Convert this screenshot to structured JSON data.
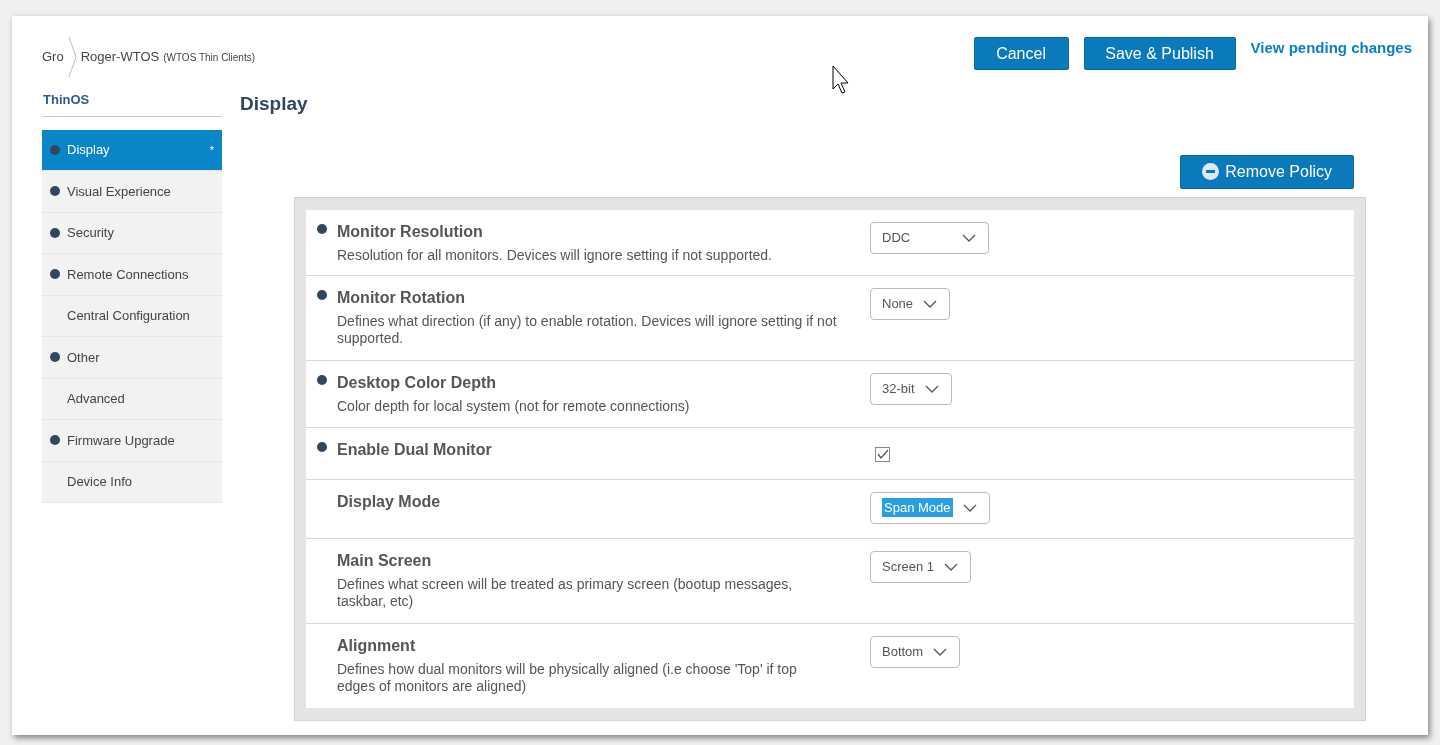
{
  "breadcrumb": {
    "parent": "Gro",
    "current": "Roger-WTOS",
    "context": "(WTOS Thin Clients)"
  },
  "header_buttons": [
    "Cancel",
    "Save & Publish"
  ],
  "pending_link": "View pending changes",
  "sidebar": {
    "title": "ThinOS",
    "items": [
      {
        "label": "Display",
        "configured": true,
        "selected": true,
        "modified_mark": "*"
      },
      {
        "label": "Visual Experience",
        "configured": true,
        "selected": false
      },
      {
        "label": "Security",
        "configured": true,
        "selected": false
      },
      {
        "label": "Remote Connections",
        "configured": true,
        "selected": false
      },
      {
        "label": "Central Configuration",
        "configured": false,
        "selected": false
      },
      {
        "label": "Other",
        "configured": true,
        "selected": false
      },
      {
        "label": "Advanced",
        "configured": false,
        "selected": false
      },
      {
        "label": "Firmware Upgrade",
        "configured": true,
        "selected": false
      },
      {
        "label": "Device Info",
        "configured": false,
        "selected": false
      }
    ]
  },
  "page_title": "Display",
  "remove_button": "Remove Policy",
  "settings": [
    {
      "kind": "select",
      "title": "Monitor Resolution",
      "description": "Resolution for all monitors. Devices will ignore setting if not supported.",
      "configured": true,
      "value": "DDC",
      "highlighted": false
    },
    {
      "kind": "select",
      "title": "Monitor Rotation",
      "description": "Defines what direction (if any) to enable rotation. Devices will ignore setting if not supported.",
      "configured": true,
      "value": "None",
      "highlighted": false
    },
    {
      "kind": "select",
      "title": "Desktop Color Depth",
      "description": "Color depth for local system (not for remote connections)",
      "configured": true,
      "value": "32-bit",
      "highlighted": false
    },
    {
      "kind": "checkbox",
      "title": "Enable Dual Monitor",
      "configured": true,
      "checked": true
    },
    {
      "kind": "select",
      "title": "Display Mode",
      "configured": false,
      "value": "Span Mode",
      "highlighted": true
    },
    {
      "kind": "select",
      "title": "Main Screen",
      "description": "Defines what screen will be treated as primary screen (bootup messages, taskbar, etc)",
      "configured": false,
      "value": "Screen 1",
      "highlighted": false
    },
    {
      "kind": "select",
      "title": "Alignment",
      "description": "Defines how dual monitors will be physically aligned (i.e choose 'Top' if top edges of monitors are aligned)",
      "configured": false,
      "value": "Bottom",
      "highlighted": false
    }
  ]
}
